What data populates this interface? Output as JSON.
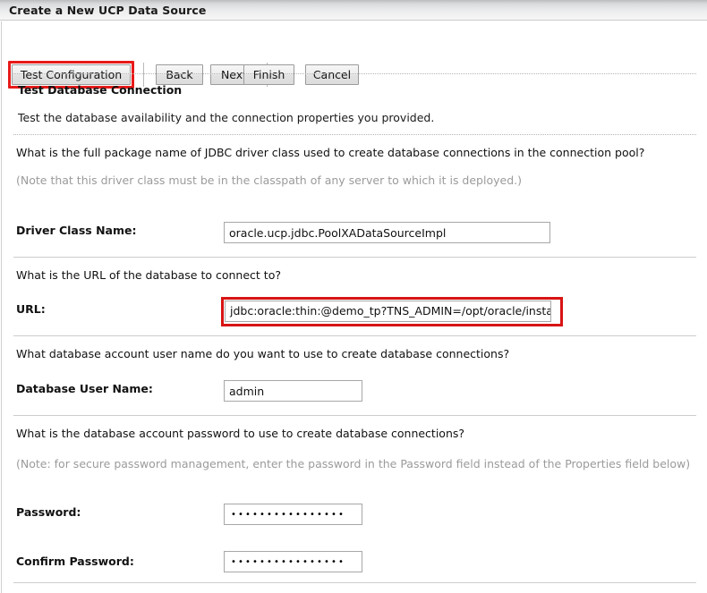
{
  "window": {
    "title": "Create a New UCP Data Source"
  },
  "toolbar": {
    "buttons": [
      {
        "label": "Test Configuration",
        "highlighted": true
      },
      {
        "label": "Back",
        "highlighted": false
      },
      {
        "label": "Next",
        "highlighted": false
      },
      {
        "label": "Finish",
        "highlighted": false
      },
      {
        "label": "Cancel",
        "highlighted": false
      }
    ]
  },
  "page": {
    "heading": "Test Database Connection",
    "subheading": "Test the database availability and the connection properties you provided."
  },
  "sections": {
    "driver": {
      "question": "What is the full package name of JDBC driver class used to create database connections in the connection pool?",
      "note": "(Note that this driver class must be in the classpath of any server to which it is deployed.)",
      "label": "Driver Class Name:",
      "value": "oracle.ucp.jdbc.PoolXADataSourceImpl"
    },
    "url": {
      "question": "What is the URL of the database to connect to?",
      "label": "URL:",
      "value": "jdbc:oracle:thin:@demo_tp?TNS_ADMIN=/opt/oracle/instantclient",
      "highlighted": true
    },
    "user": {
      "question": "What database account user name do you want to use to create database connections?",
      "label": "Database User Name:",
      "value": "admin"
    },
    "password": {
      "question": "What is the database account password to use to create database connections?",
      "note": "(Note: for secure password management, enter the password in the Password field instead of the Properties field below)",
      "label": "Password:",
      "masked_value": "••••••••••••••••",
      "confirm_label": "Confirm Password:",
      "confirm_masked_value": "••••••••••••••••"
    }
  },
  "colors": {
    "highlight_red": "#d81414",
    "button_highlight_red": "#e81a1a",
    "note_gray": "#9b9b9b",
    "separator_gray": "#cdcdcd"
  }
}
